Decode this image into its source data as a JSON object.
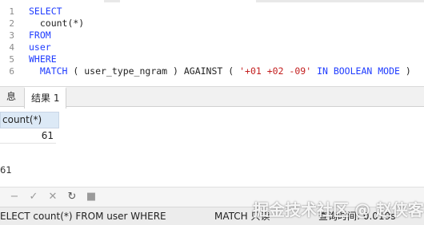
{
  "sql_lines": [
    {
      "num": "1",
      "tokens": [
        {
          "t": "SELECT",
          "c": "kw"
        }
      ]
    },
    {
      "num": "2",
      "tokens": [
        {
          "t": "  count(*)",
          "c": "pl"
        }
      ]
    },
    {
      "num": "3",
      "tokens": [
        {
          "t": "FROM",
          "c": "kw"
        }
      ]
    },
    {
      "num": "4",
      "tokens": [
        {
          "t": "user",
          "c": "kw"
        }
      ]
    },
    {
      "num": "5",
      "tokens": [
        {
          "t": "WHERE",
          "c": "kw"
        }
      ]
    },
    {
      "num": "6",
      "tokens": [
        {
          "t": "  MATCH",
          "c": "kw"
        },
        {
          "t": " ( user_type_ngram ) AGAINST ( ",
          "c": "pl"
        },
        {
          "t": "'+01 +02 -09'",
          "c": "str"
        },
        {
          "t": " ",
          "c": "pl"
        },
        {
          "t": "IN BOOLEAN MODE",
          "c": "kw"
        },
        {
          "t": " )",
          "c": "pl"
        }
      ]
    }
  ],
  "tabs": {
    "info": "息",
    "result": "结果 1"
  },
  "grid": {
    "column": "count(*)",
    "value": "61"
  },
  "row_count": "61",
  "toolbar": {
    "icons": [
      "minus-icon",
      "check-icon",
      "cancel-icon",
      "refresh-icon",
      "stop-icon"
    ]
  },
  "status": {
    "query": "ELECT    count(*)  FROM user WHERE",
    "match": "MATCH 只读",
    "time": "查询时间: 0.019s"
  },
  "watermark": "掘金技术社区 @ 赵侠客"
}
